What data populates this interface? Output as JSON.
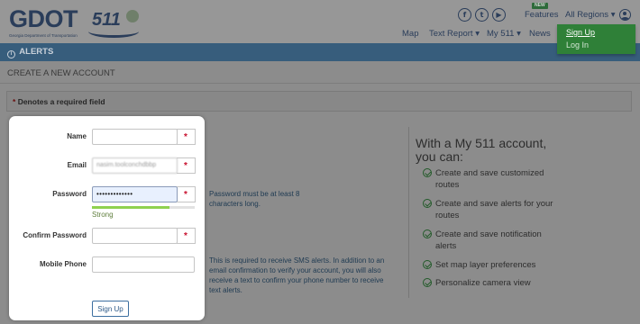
{
  "header": {
    "logo_main": "GDOT",
    "logo_sub": "Georgia Department of Transportation",
    "logo_511": "511",
    "social_icons": [
      "facebook-icon",
      "twitter-icon",
      "youtube-icon"
    ],
    "features_label": "Features",
    "new_badge": "NEW",
    "regions_label": "All Regions",
    "nav": [
      "Map",
      "Text Report",
      "My 511",
      "News"
    ]
  },
  "alerts_bar": {
    "label": "ALERTS"
  },
  "page": {
    "title": "CREATE A NEW ACCOUNT",
    "required_note": "Denotes a required field"
  },
  "form": {
    "name_label": "Name",
    "name_value": "",
    "email_label": "Email",
    "email_value": "nasim.toolconchdbbp",
    "password_label": "Password",
    "password_value": "•••••••••••••",
    "password_strength": "Strong",
    "password_strength_fraction": 0.75,
    "confirm_label": "Confirm Password",
    "confirm_value": "",
    "phone_label": "Mobile Phone",
    "phone_value": "",
    "signup_label": "Sign Up",
    "required_marker": "*"
  },
  "hints": {
    "password_line1": "Password must be at least 8",
    "password_line2": "characters long.",
    "phone_lines": [
      "This is required to receive SMS alerts. In addition to an",
      "email confirmation to verify your account, you will also",
      "receive a text to confirm your phone number to receive",
      "text alerts."
    ]
  },
  "promo": {
    "title": "With a My 511 account, you can:",
    "benefits": [
      "Create and save customized routes",
      "Create and save alerts for your routes",
      "Create and save notification alerts",
      "Set map layer preferences",
      "Personalize camera view"
    ]
  },
  "dropdown": {
    "items": [
      "Sign Up",
      "Log In"
    ]
  },
  "colors": {
    "overlay": "#8c8c8c",
    "alerts_bar": "#375d7c",
    "dropdown_bg": "#2f8038",
    "required_red": "#c8102e",
    "strength_green": "#8fd14f"
  }
}
